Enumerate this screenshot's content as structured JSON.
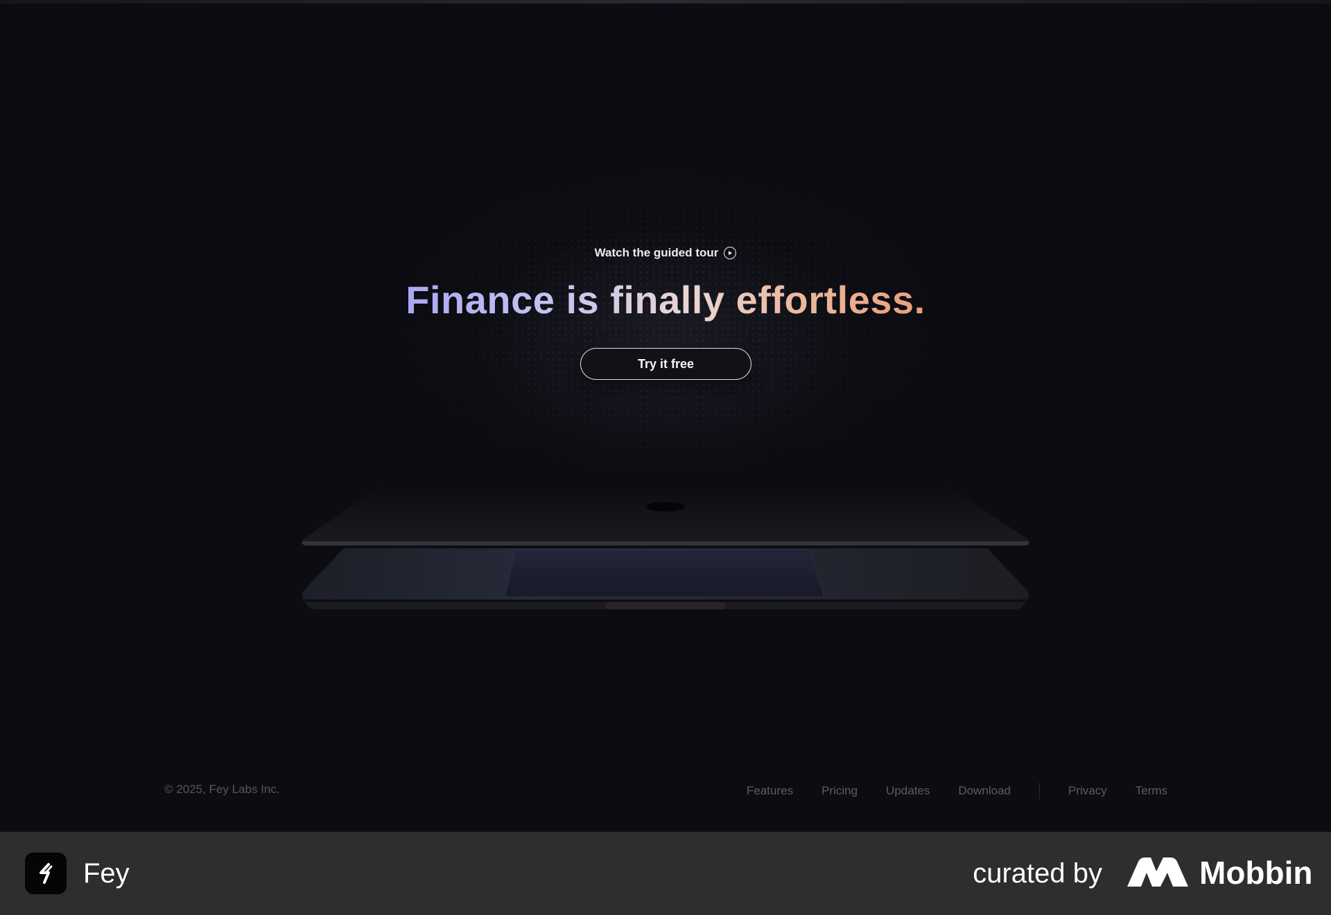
{
  "hero": {
    "tour_link": "Watch the guided tour",
    "headline": "Finance is finally effortless.",
    "cta": "Try it free"
  },
  "footer": {
    "copyright": "© 2025, Fey Labs Inc.",
    "nav": [
      "Features",
      "Pricing",
      "Updates",
      "Download"
    ],
    "legal": [
      "Privacy",
      "Terms"
    ]
  },
  "bottom_bar": {
    "app_name": "Fey",
    "curated_by": "curated by",
    "brand": "Mobbin"
  },
  "icons": {
    "tour": "play-circle-icon",
    "app": "fey-logo-icon",
    "brand": "mobbin-logo-icon"
  },
  "colors": {
    "background": "#0c0c12",
    "bottom_bar": "#2e2e2e",
    "headline_gradient_start": "#a9a8f2",
    "headline_gradient_end": "#e89f7a"
  }
}
